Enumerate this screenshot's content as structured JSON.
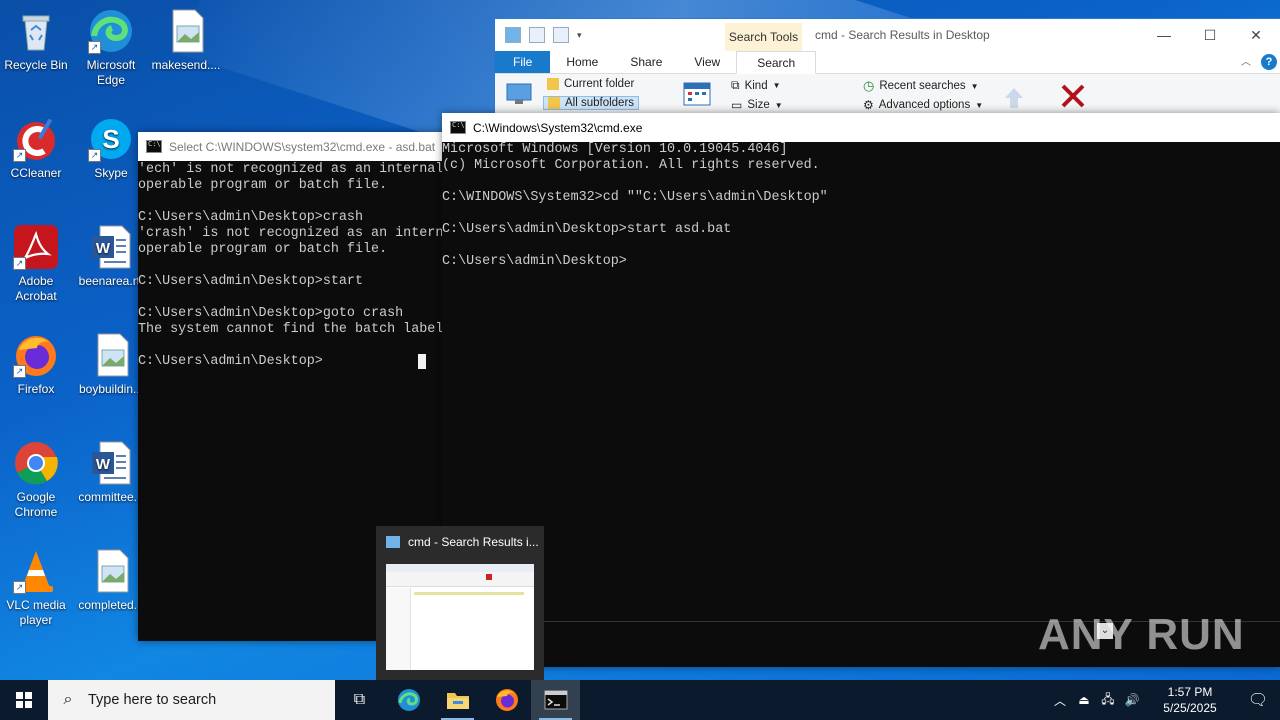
{
  "desktop_icons": [
    {
      "label": "Recycle Bin",
      "icon": "recycle-bin-icon"
    },
    {
      "label": "Microsoft Edge",
      "icon": "edge-icon"
    },
    {
      "label": "makesend....",
      "icon": "image-file-icon"
    },
    {
      "label": "CCleaner",
      "icon": "ccleaner-icon"
    },
    {
      "label": "Skype",
      "icon": "skype-icon"
    },
    {
      "label": "Adobe Acrobat",
      "icon": "acrobat-icon"
    },
    {
      "label": "beenarea.rtf",
      "icon": "word-doc-icon"
    },
    {
      "label": "Firefox",
      "icon": "firefox-icon"
    },
    {
      "label": "boybuildin...",
      "icon": "image-file-icon"
    },
    {
      "label": "Google Chrome",
      "icon": "chrome-icon"
    },
    {
      "label": "committee...",
      "icon": "word-doc-icon"
    },
    {
      "label": "VLC media player",
      "icon": "vlc-icon"
    },
    {
      "label": "completed...",
      "icon": "image-file-icon"
    }
  ],
  "explorer": {
    "search_tools": "Search Tools",
    "caption": "cmd - Search Results in Desktop",
    "tabs": [
      "File",
      "Home",
      "Share",
      "View",
      "Search"
    ],
    "ribbon": {
      "current_folder": "Current folder",
      "all_subfolders": "All subfolders",
      "kind": "Kind",
      "size": "Size",
      "recent_searches": "Recent searches",
      "advanced_options": "Advanced options"
    }
  },
  "cmd_back": {
    "title": "Select C:\\WINDOWS\\system32\\cmd.exe - asd.bat",
    "lines": [
      "'ech' is not recognized as an internal",
      "operable program or batch file.",
      "",
      "C:\\Users\\admin\\Desktop>crash",
      "'crash' is not recognized as an intern",
      "operable program or batch file.",
      "",
      "C:\\Users\\admin\\Desktop>start",
      "",
      "C:\\Users\\admin\\Desktop>goto crash",
      "The system cannot find the batch label",
      "",
      "C:\\Users\\admin\\Desktop>"
    ]
  },
  "cmd_front": {
    "title": "C:\\Windows\\System32\\cmd.exe",
    "lines": [
      "Microsoft Windows [Version 10.0.19045.4046]",
      "(c) Microsoft Corporation. All rights reserved.",
      "",
      "C:\\WINDOWS\\System32>cd \"\"C:\\Users\\admin\\Desktop\"",
      "",
      "C:\\Users\\admin\\Desktop>start asd.bat",
      "",
      "C:\\Users\\admin\\Desktop>"
    ]
  },
  "thumbnail": {
    "title": "cmd - Search Results i..."
  },
  "taskbar": {
    "search_placeholder": "Type here to search",
    "time": "1:57 PM",
    "date": "5/25/2025"
  },
  "watermark": "ANY RUN",
  "colors": {
    "accent": "#1979ca",
    "desktop": "#0b62c9",
    "taskbar": "#0b1a2c",
    "terminal_bg": "#0c0c0c",
    "terminal_fg": "#cccccc"
  }
}
